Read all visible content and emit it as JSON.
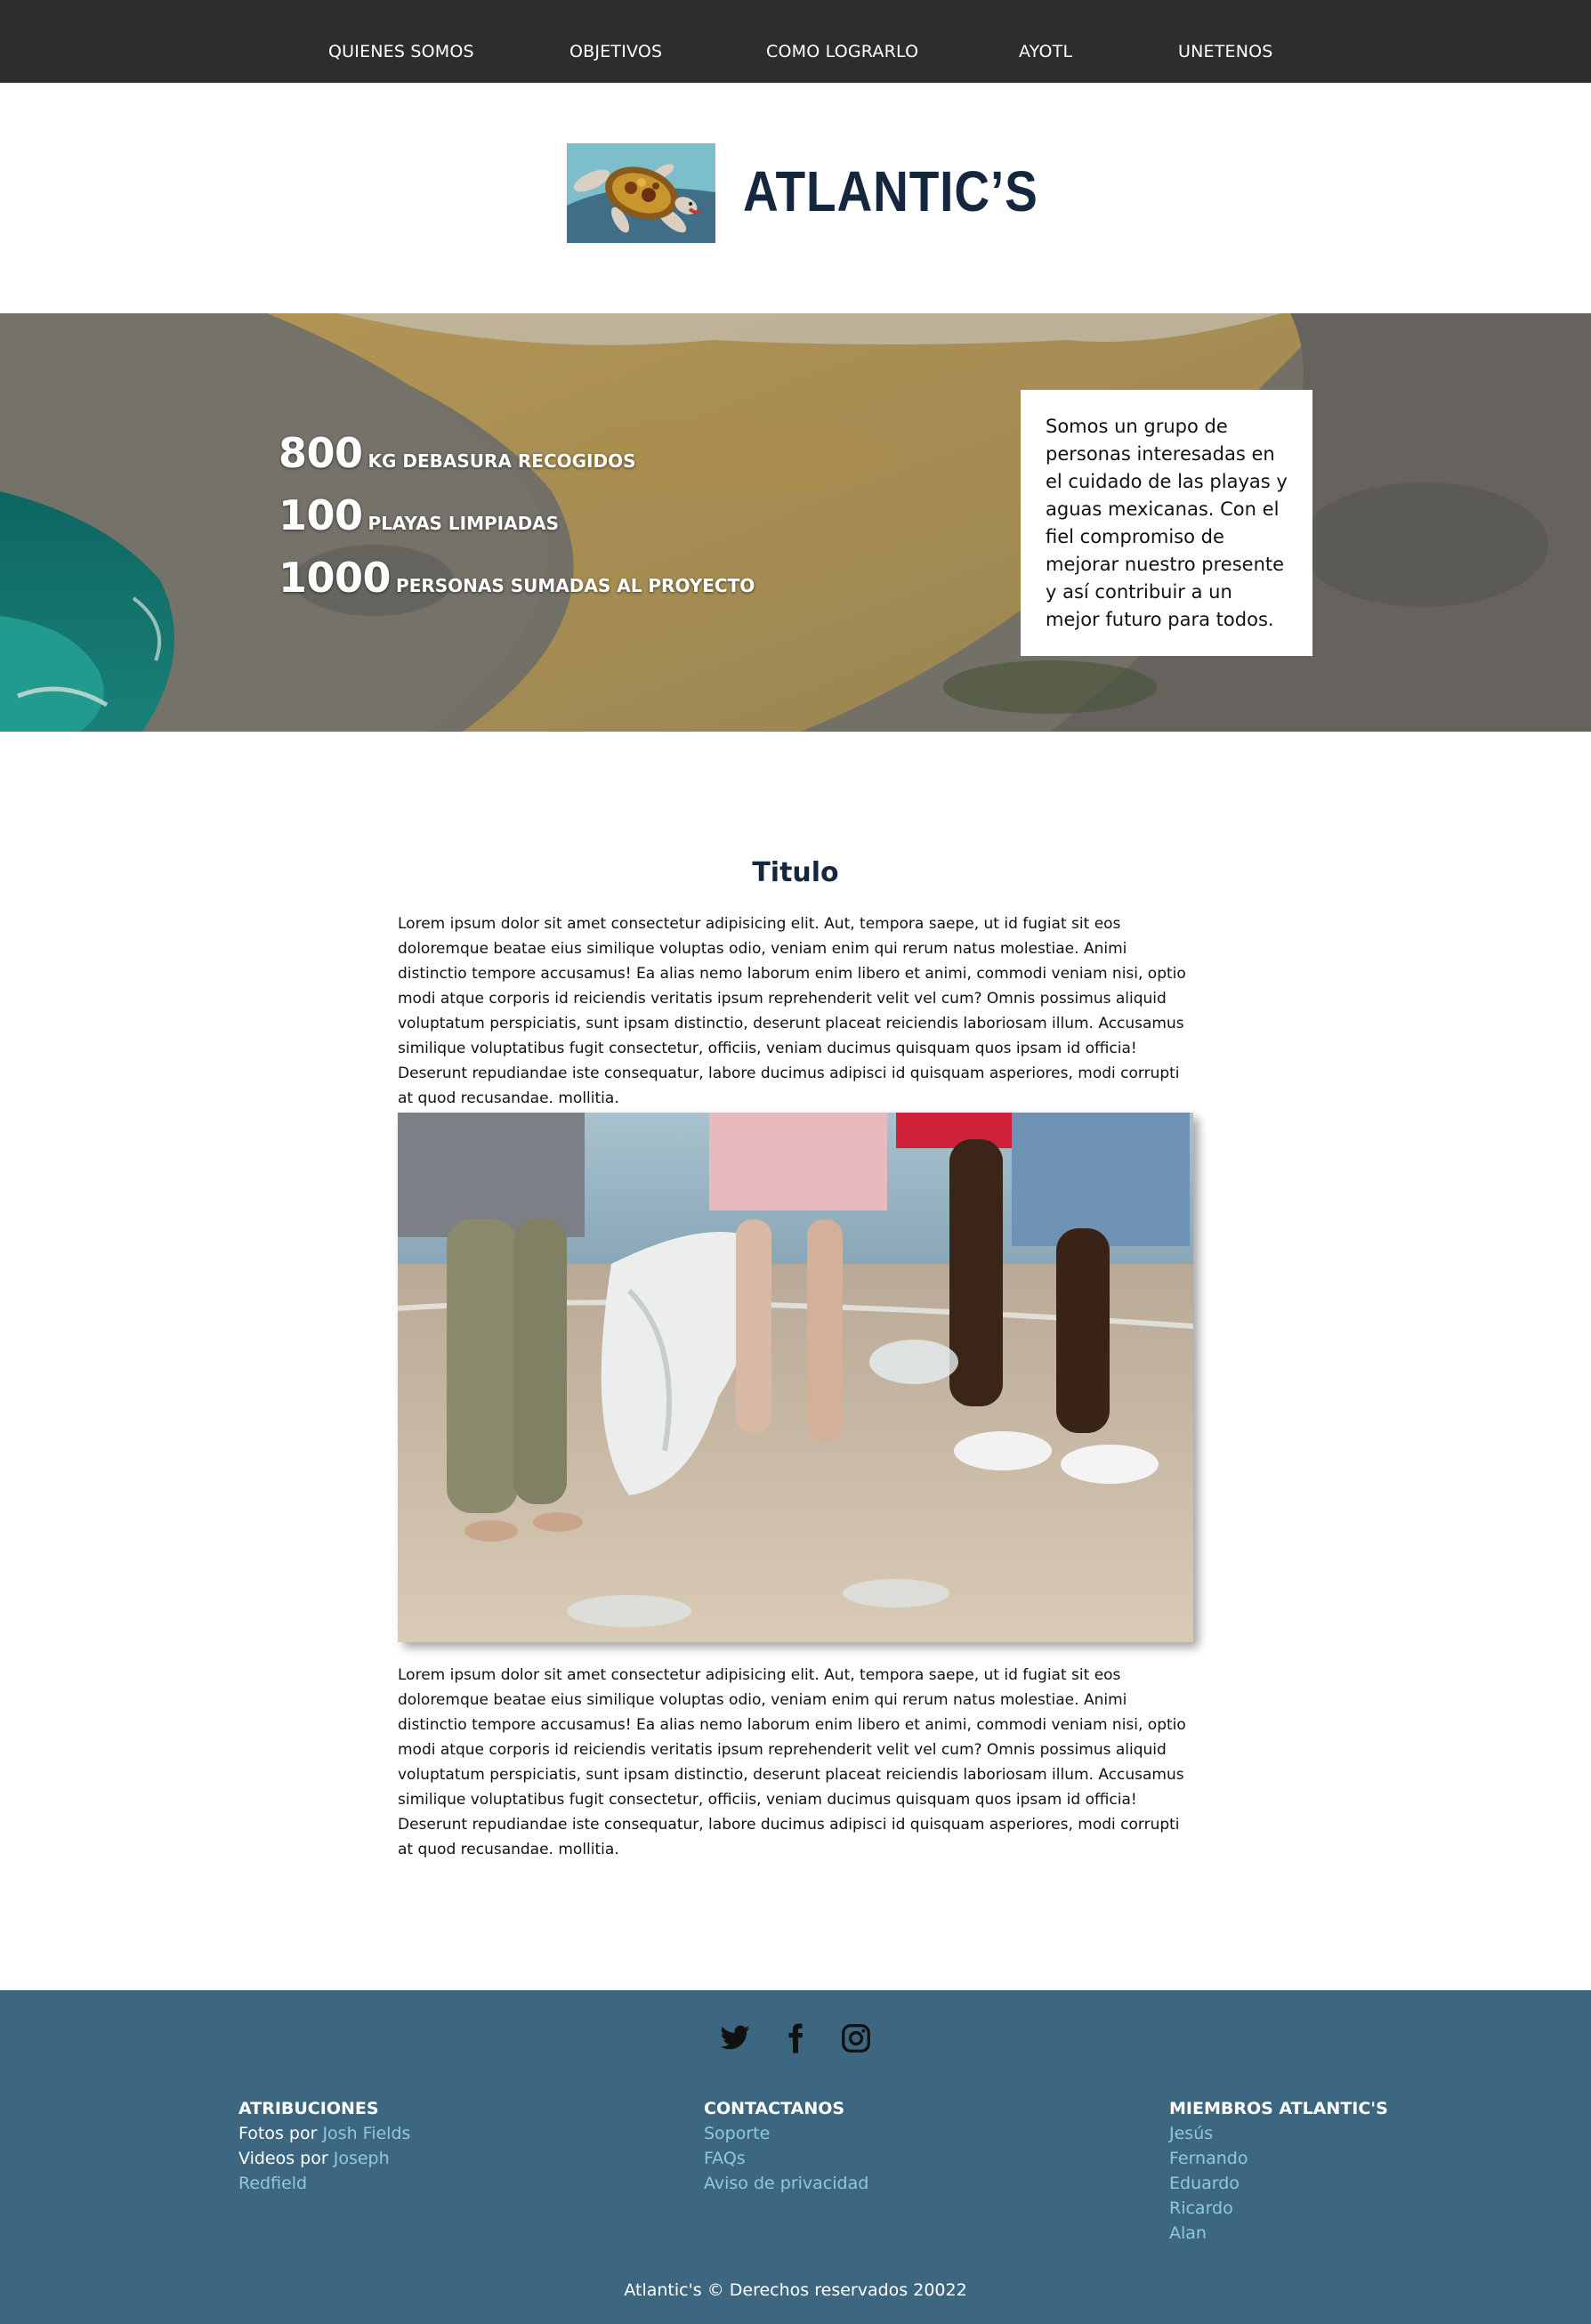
{
  "nav": {
    "items": [
      "QUIENES SOMOS",
      "OBJETIVOS",
      "COMO LOGRARLO",
      "AYOTL",
      "UNETENOS"
    ]
  },
  "brand": {
    "name": "ATLANTIC’S",
    "logo_icon": "sea-turtle-logo"
  },
  "hero": {
    "stats": [
      {
        "number": "800",
        "label": "KG DEBASURA RECOGIDOS"
      },
      {
        "number": "100",
        "label": "PLAYAS LIMPIADAS"
      },
      {
        "number": "1000",
        "label": "PERSONAS SUMADAS AL PROYECTO"
      }
    ],
    "about": "Somos un grupo de personas interesadas en el cuidado de las playas y aguas mexicanas. Con el fiel compromiso de mejorar nuestro presente y así contribuir a un mejor futuro para todos."
  },
  "content": {
    "title": "Titulo",
    "paragraph1": "Lorem ipsum dolor sit amet consectetur adipisicing elit. Aut, tempora saepe, ut id fugiat sit eos doloremque beatae eius similique voluptas odio, veniam enim qui rerum natus molestiae. Animi distinctio tempore accusamus! Ea alias nemo laborum enim libero et animi, commodi veniam nisi, optio modi atque corporis id reiciendis veritatis ipsum reprehenderit velit vel cum? Omnis possimus aliquid voluptatum perspiciatis, sunt ipsam distinctio, deserunt placeat reiciendis laboriosam illum. Accusamus similique voluptatibus fugit consectetur, officiis, veniam ducimus quisquam quos ipsam id officia! Deserunt repudiandae iste consequatur, labore ducimus adipisci id quisquam asperiores, modi corrupti at quod recusandae. mollitia.",
    "paragraph2": "Lorem ipsum dolor sit amet consectetur adipisicing elit. Aut, tempora saepe, ut id fugiat sit eos doloremque beatae eius similique voluptas odio, veniam enim qui rerum natus molestiae. Animi distinctio tempore accusamus! Ea alias nemo laborum enim libero et animi, commodi veniam nisi, optio modi atque corporis id reiciendis veritatis ipsum reprehenderit velit vel cum? Omnis possimus aliquid voluptatum perspiciatis, sunt ipsam distinctio, deserunt placeat reiciendis laboriosam illum. Accusamus similique voluptatibus fugit consectetur, officiis, veniam ducimus quisquam quos ipsam id officia! Deserunt repudiandae iste consequatur, labore ducimus adipisci id quisquam asperiores, modi corrupti at quod recusandae. mollitia."
  },
  "footer": {
    "social_icons": [
      "twitter-icon",
      "facebook-icon",
      "instagram-icon"
    ],
    "atribuciones": {
      "heading": "ATRIBUCIONES",
      "fotos_prefix": "Fotos por",
      "fotos_author": "Josh Fields",
      "videos_prefix": "Videos por",
      "videos_author_1": "Joseph",
      "videos_author_2": "Redfield"
    },
    "contactanos": {
      "heading": "CONTACTANOS",
      "links": [
        "Soporte",
        "FAQs",
        "Aviso de privacidad"
      ]
    },
    "miembros": {
      "heading": "MIEMBROS ATLANTIC'S",
      "names": [
        "Jesús",
        "Fernando",
        "Eduardo",
        "Ricardo",
        "Alan"
      ]
    },
    "copyright": "Atlantic's © Derechos reservados 20022"
  },
  "colors": {
    "nav_bg": "#2d2d2d",
    "brand_text": "#14273f",
    "footer_bg": "#3d6680",
    "footer_link": "#8fc8e2"
  }
}
